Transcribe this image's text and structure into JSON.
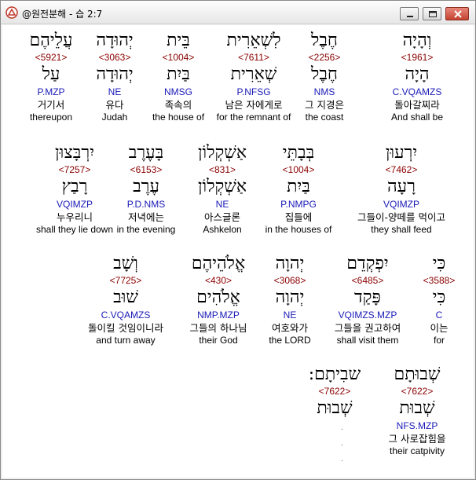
{
  "window": {
    "title": "@원전분해 - 습 2:7"
  },
  "rows": [
    {
      "top": 0,
      "words": [
        {
          "heb": "וְהָיָה",
          "num": "<1961>",
          "lemma": "הָיָה",
          "parse": "C.VQAMZS",
          "kor": "돌아갈찌라",
          "eng": "And shall be"
        },
        {
          "heb": "חֶבֶל",
          "num": "<2256>",
          "lemma": "חֶבֶל",
          "parse": "NMS",
          "kor": "그 지경은",
          "eng": "the coast"
        },
        {
          "heb": "לִשְׁאֵרִית",
          "num": "<7611>",
          "lemma": "שְׁאֵרִית",
          "parse": "P.NFSG",
          "kor": "남은 자에게로",
          "eng": "for the remnant of"
        },
        {
          "heb": "בֵּית",
          "num": "<1004>",
          "lemma": "בַּיִת",
          "parse": "NMSG",
          "kor": "족속의",
          "eng": "the house of"
        },
        {
          "heb": "יְהוּדָה",
          "num": "<3063>",
          "lemma": "יְהוּדָה",
          "parse": "NE",
          "kor": "유다",
          "eng": "Judah"
        },
        {
          "heb": "עֲלֵיהֶם",
          "num": "<5921>",
          "lemma": "עַל",
          "parse": "P.MZP",
          "kor": "거기서",
          "eng": "thereupon"
        }
      ]
    },
    {
      "words": [
        {
          "heb": "יִרְעוּן",
          "num": "<7462>",
          "lemma": "רָעָה",
          "parse": "VQIMZP",
          "kor": "그들이-양떼를 먹이고",
          "eng": "they shall feed"
        },
        {
          "heb": "בְּבָתֵּי",
          "num": "<1004>",
          "lemma": "בַּיִת",
          "parse": "P.NMPG",
          "kor": "집들에",
          "eng": "in the houses of"
        },
        {
          "heb": "אַשְׁקְלוֹן",
          "num": "<831>",
          "lemma": "אַשְׁקְלוֹן",
          "parse": "NE",
          "kor": "아스글론",
          "eng": "Ashkelon"
        },
        {
          "heb": "בָּעֶרֶב",
          "num": "<6153>",
          "lemma": "עֶרֶב",
          "parse": "P.D.NMS",
          "kor": "저녁에는",
          "eng": "in the evening"
        },
        {
          "heb": "יִרְבָּצוּן",
          "num": "<7257>",
          "lemma": "רָבַץ",
          "parse": "VQIMZP",
          "kor": "누우리니",
          "eng": "shall they lie down"
        }
      ]
    },
    {
      "words": [
        {
          "heb": "כִּי",
          "num": "<3588>",
          "lemma": "כִּי",
          "parse": "C",
          "kor": "이는",
          "eng": "for"
        },
        {
          "heb": "יִפְקְדֵם",
          "num": "<6485>",
          "lemma": "פָּקַד",
          "parse": "VQIMZS.MZP",
          "kor": "그들을 권고하여",
          "eng": "shall visit them"
        },
        {
          "heb": "יְהוָה",
          "num": "<3068>",
          "lemma": "יְהוָה",
          "parse": "NE",
          "kor": "여호와가",
          "eng": "the LORD"
        },
        {
          "heb": "אֱלֹהֵיהֶם",
          "num": "<430>",
          "lemma": "אֱלֹהִים",
          "parse": "NMP.MZP",
          "kor": "그들의 하나님",
          "eng": "their God"
        },
        {
          "heb": "וְשָׁב",
          "num": "<7725>",
          "lemma": "שׁוּב",
          "parse": "C.VQAMZS",
          "kor": "돌이킬 것임이니라",
          "eng": "and turn away"
        }
      ]
    },
    {
      "words": [
        {
          "heb": "שְׁבוּתָם",
          "num": "<7622>",
          "lemma": "שְׁבוּת",
          "parse": "NFS.MZP",
          "kor": "그 사로잡힘을",
          "eng": "their catpivity"
        },
        {
          "heb": "שבִיתָם:",
          "num": "<7622>",
          "lemma": "שְׁבוּת",
          "parse": "",
          "kor": "",
          "eng": ""
        }
      ]
    }
  ]
}
